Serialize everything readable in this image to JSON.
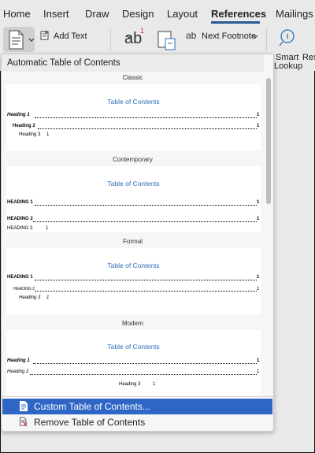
{
  "tabs": [
    "Home",
    "Insert",
    "Draw",
    "Design",
    "Layout",
    "References",
    "Mailings"
  ],
  "active_tab": "References",
  "ribbon": {
    "add_text": "Add Text",
    "next_footnote": "Next Footnote",
    "footnote_glyph": "ab",
    "footnote_sup": "1",
    "smart_label": "Smart",
    "lookup_label": "Lookup",
    "res_label": "Res"
  },
  "panel": {
    "header": "Automatic Table of Contents",
    "styles": [
      {
        "name": "Classic",
        "title": "Table of Contents",
        "l1": "Heading 1",
        "l2": "Heading 2",
        "l3": "Heading 3",
        "num": "1"
      },
      {
        "name": "Contemporary",
        "title": "Table of Contents",
        "l1": "HEADING 1",
        "l2": "HEADING 2",
        "l3": "HEADING 3",
        "num": "1"
      },
      {
        "name": "Formal",
        "title": "Table of Contents",
        "l1": "HEADING 1",
        "l2": "HEADING 2",
        "l3": "Heading 3",
        "num": "1"
      },
      {
        "name": "Modern",
        "title": "Table of Contents",
        "l1": "Heading 1",
        "l2": "Heading 2",
        "l3": "Heading 3",
        "num": "1"
      }
    ],
    "menu": {
      "custom": "Custom Table of Contents...",
      "remove": "Remove Table of Contents"
    }
  },
  "colors": {
    "accent": "#2f66c6",
    "toc_title": "#2f6fb8",
    "underline": "#2b5797"
  }
}
